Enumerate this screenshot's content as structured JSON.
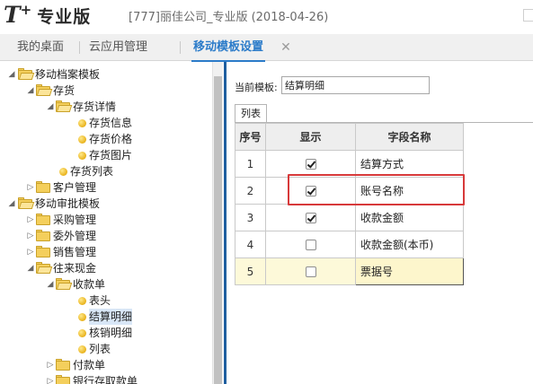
{
  "app": {
    "logo_t": "T",
    "logo_plus": "+",
    "product": "专业版",
    "company": "[777]丽佳公司_专业版 (2018-04-26)"
  },
  "tabs": [
    {
      "label": "我的桌面",
      "active": false
    },
    {
      "label": "云应用管理",
      "active": false
    },
    {
      "label": "移动模板设置",
      "active": true,
      "close_icon": "close-icon",
      "close_glyph": "✕"
    }
  ],
  "tree": {
    "nodes": [
      {
        "label": "移动档案模板",
        "type": "folder-open",
        "expander": "expanded"
      },
      {
        "label": "存货",
        "type": "folder-open",
        "expander": "expanded"
      },
      {
        "label": "存货详情",
        "type": "folder-open",
        "expander": "expanded"
      },
      {
        "label": "存货信息",
        "type": "leaf"
      },
      {
        "label": "存货价格",
        "type": "leaf"
      },
      {
        "label": "存货图片",
        "type": "leaf"
      },
      {
        "label": "存货列表",
        "type": "leaf"
      },
      {
        "label": "客户管理",
        "type": "folder",
        "expander": "collapsed"
      },
      {
        "label": "移动审批模板",
        "type": "folder-open",
        "expander": "expanded"
      },
      {
        "label": "采购管理",
        "type": "folder",
        "expander": "collapsed"
      },
      {
        "label": "委外管理",
        "type": "folder",
        "expander": "collapsed"
      },
      {
        "label": "销售管理",
        "type": "folder",
        "expander": "collapsed"
      },
      {
        "label": "往来现金",
        "type": "folder-open",
        "expander": "expanded"
      },
      {
        "label": "收款单",
        "type": "folder-open",
        "expander": "expanded"
      },
      {
        "label": "表头",
        "type": "leaf"
      },
      {
        "label": "结算明细",
        "type": "leaf",
        "selected": true
      },
      {
        "label": "核销明细",
        "type": "leaf"
      },
      {
        "label": "列表",
        "type": "leaf"
      },
      {
        "label": "付款单",
        "type": "folder",
        "expander": "collapsed"
      },
      {
        "label": "银行存取款单",
        "type": "folder",
        "expander": "collapsed"
      }
    ]
  },
  "editor": {
    "template_label": "当前模板:",
    "template_value": "结算明细",
    "subtab_label": "列表",
    "columns": {
      "seq": "序号",
      "show": "显示",
      "field": "字段名称"
    },
    "rows": [
      {
        "seq": "1",
        "show": true,
        "field": "结算方式"
      },
      {
        "seq": "2",
        "show": true,
        "field": "账号名称",
        "highlighted": true
      },
      {
        "seq": "3",
        "show": true,
        "field": "收款金额"
      },
      {
        "seq": "4",
        "show": false,
        "field": "收款金额(本币)"
      },
      {
        "seq": "5",
        "show": false,
        "field": "票据号",
        "current": true
      }
    ]
  },
  "colors": {
    "accent": "#2b7bc9",
    "highlight": "#d7393a",
    "selected_row": "#fdf9d9"
  }
}
